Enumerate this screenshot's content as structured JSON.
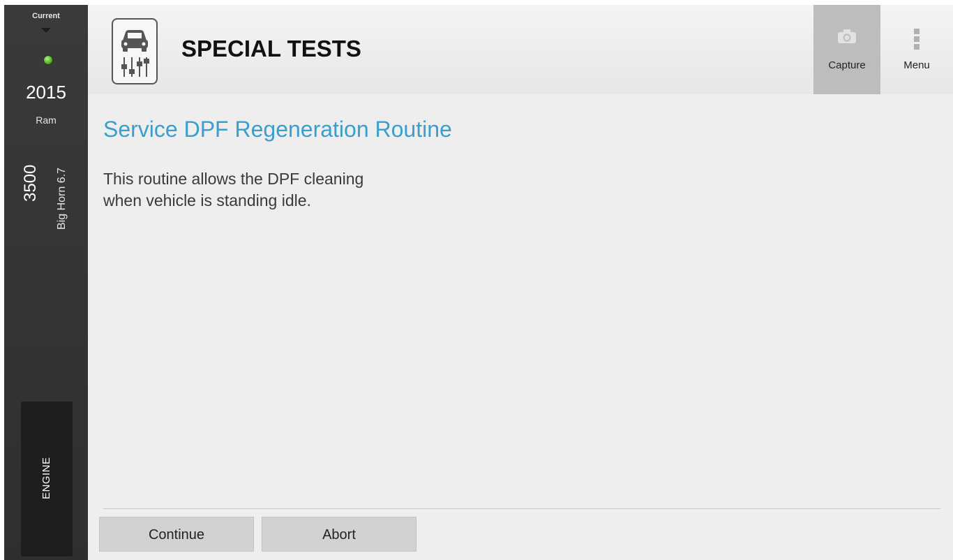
{
  "sidebar": {
    "current_label": "Current",
    "status": "connected",
    "year": "2015",
    "make": "Ram",
    "model": "3500",
    "trim": "Big Horn 6.7",
    "system_tab": "ENGINE"
  },
  "header": {
    "title": "SPECIAL TESTS",
    "capture_label": "Capture",
    "menu_label": "Menu"
  },
  "main": {
    "page_title": "Service DPF Regeneration Routine",
    "description": "This routine allows the DPF cleaning\nwhen vehicle is standing idle."
  },
  "footer": {
    "continue_label": "Continue",
    "abort_label": "Abort"
  },
  "colors": {
    "accent": "#3a9fcc",
    "sidebar_bg": "#333333",
    "status_led": "#55b82a"
  },
  "icons": {
    "app_icon": "car-diagnostics-icon",
    "capture_icon": "camera-icon",
    "menu_icon": "vertical-dots-icon"
  }
}
